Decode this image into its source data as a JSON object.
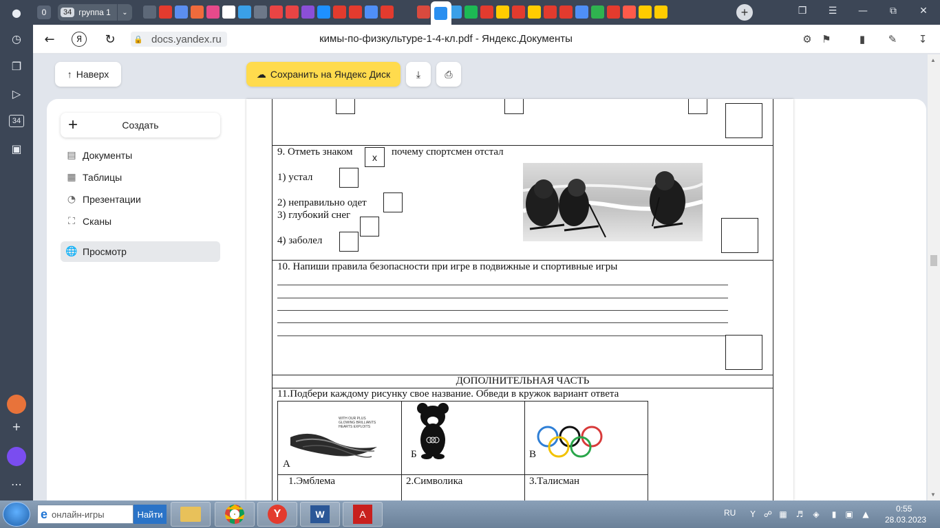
{
  "browser": {
    "tab_counter": "0",
    "group_count": "34",
    "group_label": "группа 1",
    "url_domain": "docs.yandex.ru",
    "page_title": "кимы-по-физкультуре-1-4-кл.pdf - Яндекс.Документы",
    "left_badge": "34",
    "favicon_colors": [
      "#5d6878",
      "#e33b2e",
      "#5b8ef0",
      "#f06b3c",
      "#e64a8b",
      "#ffffff",
      "#3aa0e8",
      "#6d7889",
      "#e94444",
      "#e94444",
      "#8b4fd8",
      "#1e90ff",
      "#e33b2e",
      "#e33b2e",
      "#4f8ff7",
      "#e33b2e",
      "#2a8ff0",
      "#d94a3e",
      "#e6c224",
      "#3aa0e8",
      "#1db954",
      "#e33b2e",
      "#ffcc00",
      "#e33b2e",
      "#ffcc00",
      "#e33b2e",
      "#e33b2e",
      "#4f8ff7",
      "#2fb34f",
      "#e33b2e",
      "#ff5a4a",
      "#ffcc00",
      "#ffcc00"
    ]
  },
  "toolbar": {
    "up_label": "Наверх",
    "save_label": "Сохранить на Яндекс Диск"
  },
  "sidebar": {
    "create_label": "Создать",
    "items": [
      {
        "label": "Документы",
        "icon": "document-icon"
      },
      {
        "label": "Таблицы",
        "icon": "table-icon"
      },
      {
        "label": "Презентации",
        "icon": "presentation-icon"
      },
      {
        "label": "Сканы",
        "icon": "scan-icon"
      },
      {
        "label": "Просмотр",
        "icon": "globe-icon"
      }
    ]
  },
  "document": {
    "q9": {
      "prompt_a": "9. Отметь знаком",
      "mark": "х",
      "prompt_b": "почему спортсмен отстал",
      "options": [
        "1) устал",
        "2) неправильно одет",
        "3) глубокий снег",
        "4) заболел"
      ]
    },
    "q10": {
      "prompt": "10. Напиши правила безопасности при игре в подвижные и спортивные игры"
    },
    "extra_header": "ДОПОЛНИТЕЛЬНАЯ ЧАСТЬ",
    "q11": {
      "prompt": "11.Подбери  каждому рисунку свое название. Обведи в кружок вариант ответа",
      "pictures": [
        "А",
        "Б",
        "В"
      ],
      "answers": [
        "1.Эмблема",
        "2.Символика",
        "3.Талисман"
      ],
      "logo_text": [
        "WITH OUR PLUS",
        "GLOWING BRILLIANTS",
        "HEARTS EXPLOITS"
      ]
    }
  },
  "taskbar": {
    "search_value": "онлайн-игры",
    "find_label": "Найти",
    "lang": "RU",
    "time": "0:55",
    "date": "28.03.2023"
  }
}
